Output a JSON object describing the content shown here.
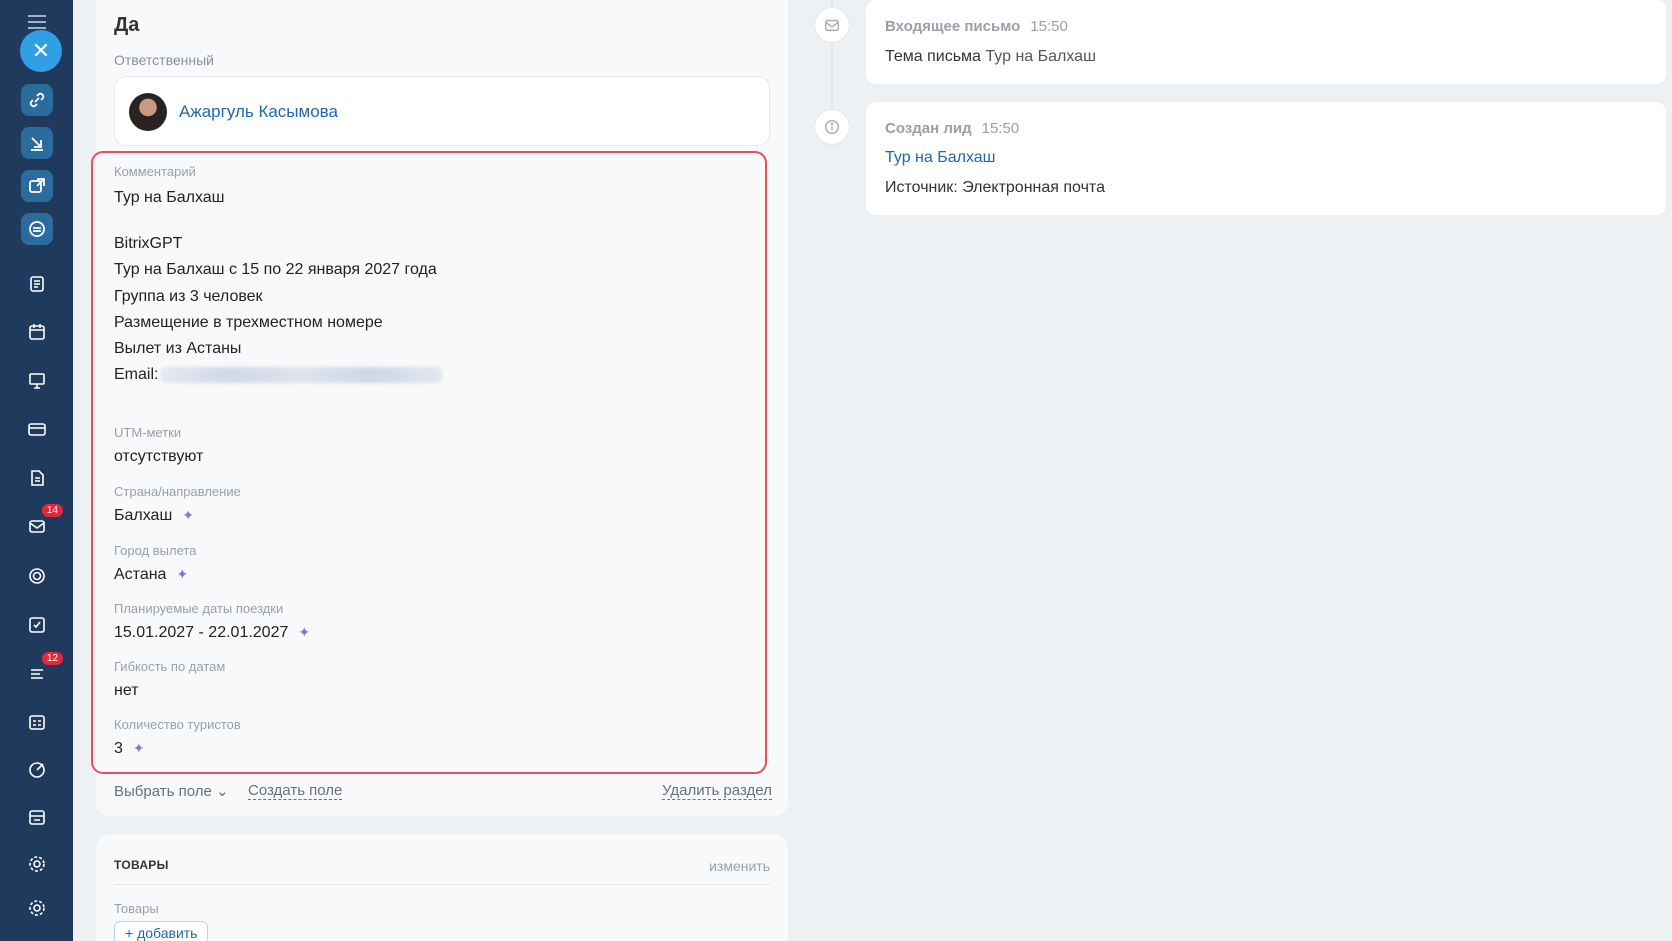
{
  "sidebar": {
    "badges": {
      "mail": "14",
      "feed": "12"
    }
  },
  "section": {
    "title": "Да",
    "responsible_label": "Ответственный",
    "responsible_name": "Ажаргуль Касымова"
  },
  "fields": {
    "comment_label": "Комментарий",
    "comment_title": "Тур на Балхаш",
    "comment_lines": [
      "BitrixGPT",
      "Тур на Балхаш с 15 по 22 января 2027 года",
      "Группа из 3 человек",
      "Размещение в трехместном номере",
      "Вылет из Астаны"
    ],
    "email_label": "Email:",
    "utm_label": "UTM-метки",
    "utm_value": "отсутствуют",
    "country_label": "Страна/направление",
    "country_value": "Балхаш",
    "city_label": "Город вылета",
    "city_value": "Астана",
    "dates_label": "Планируемые даты поездки",
    "dates_value": "15.01.2027 - 22.01.2027",
    "flex_label": "Гибкость по датам",
    "flex_value": "нет",
    "tourists_label": "Количество туристов",
    "tourists_value": "3"
  },
  "footer": {
    "select_field": "Выбрать поле",
    "create_field": "Создать поле",
    "delete_section": "Удалить раздел"
  },
  "goods": {
    "title": "ТОВАРЫ",
    "edit": "изменить",
    "label": "Товары",
    "add": "+ добавить"
  },
  "timeline": {
    "email": {
      "title": "Входящее письмо",
      "time": "15:50",
      "subject_label": "Тема письма",
      "subject": "Тур на Балхаш"
    },
    "lead": {
      "title": "Создан лид",
      "time": "15:50",
      "link": "Тур на Балхаш",
      "source": "Источник: Электронная почта"
    }
  }
}
